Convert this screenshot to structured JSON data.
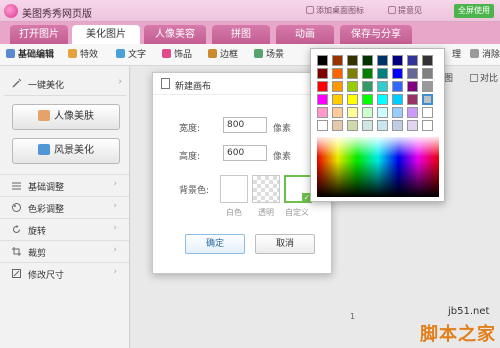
{
  "app": {
    "title": "美图秀秀网页版",
    "links": [
      "添加桌面图标",
      "提意见",
      "全屏使用"
    ]
  },
  "tabs": [
    "打开图片",
    "美化图片",
    "人像美容",
    "拼图",
    "动画",
    "保存与分享"
  ],
  "toolbar": {
    "items": [
      "基础编辑",
      "特效",
      "文字",
      "饰品",
      "边框",
      "场景",
      "理",
      "消除"
    ],
    "icons": [
      "edit-icon",
      "sparkle-icon",
      "text-icon",
      "ornament-icon",
      "frame-icon",
      "scene-icon",
      "brush-icon",
      "eraser-icon"
    ]
  },
  "sidebar": {
    "oneclick_label": "一键美化",
    "beauty_button": "人像美肤",
    "scenery_button": "风景美化",
    "items": [
      "基础调整",
      "色彩调整",
      "旋转",
      "裁剪",
      "修改尺寸"
    ]
  },
  "right_tools": [
    "图",
    "对比"
  ],
  "dialog": {
    "title": "新建画布",
    "width_label": "宽度:",
    "width_value": "800",
    "height_label": "高度:",
    "height_value": "600",
    "unit": "像素",
    "bg_label": "背景色:",
    "swatch_labels": [
      "白色",
      "透明",
      "自定义"
    ],
    "ok": "确定",
    "cancel": "取消"
  },
  "picker": {
    "rows": [
      [
        "#000000",
        "#993300",
        "#333300",
        "#003300",
        "#003366",
        "#000080",
        "#333399",
        "#333333"
      ],
      [
        "#800000",
        "#ff6600",
        "#808000",
        "#008000",
        "#008080",
        "#0000ff",
        "#666699",
        "#808080"
      ],
      [
        "#ff0000",
        "#ff9900",
        "#99cc00",
        "#339966",
        "#33cccc",
        "#3366ff",
        "#800080",
        "#999999"
      ],
      [
        "#ff00ff",
        "#ffcc00",
        "#ffff00",
        "#00ff00",
        "#00ffff",
        "#00ccff",
        "#993366",
        "#c0c0c0"
      ],
      [
        "#ff99cc",
        "#ffcc99",
        "#ffff99",
        "#ccffcc",
        "#ccffff",
        "#99ccff",
        "#cc99ff",
        "#ffffff"
      ],
      [
        "#ffffff",
        "#e5c9a8",
        "#cfd9a9",
        "#cfe7e0",
        "#c8e6ee",
        "#bfcde5",
        "#e0d4ef",
        "#ffffff"
      ]
    ],
    "selected": "#c0c0c0"
  },
  "bottom": {
    "zoom": "1",
    "watermark_site": "jb51.net",
    "watermark_name": "脚本之家"
  }
}
